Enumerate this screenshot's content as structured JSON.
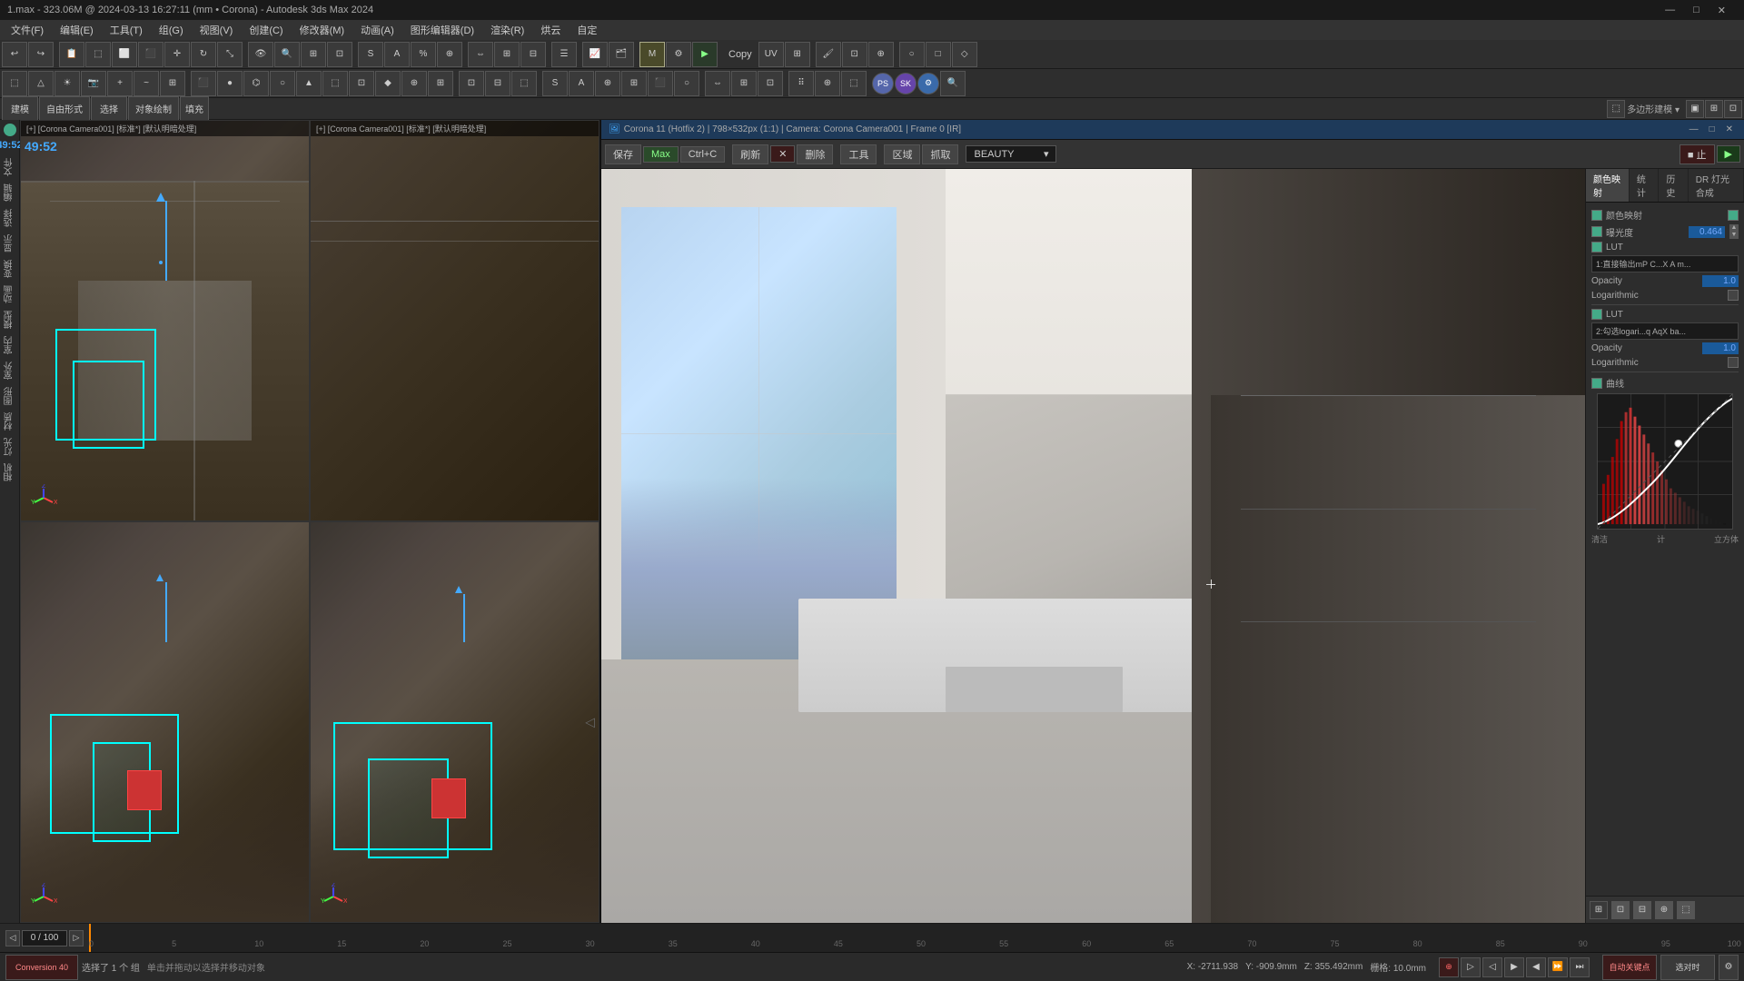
{
  "titleBar": {
    "text": "1.max - 323.06M @ 2024-03-13 16:27:11  (mm • Corona) - Autodesk 3ds Max 2024"
  },
  "menuBar": {
    "items": [
      "文件(F)",
      "编辑(E)",
      "工具(T)",
      "组(G)",
      "视图(V)",
      "创建(C)",
      "修改器(M)",
      "动画(A)",
      "图形编辑器(D)",
      "渲染(R)",
      "烘云",
      "自定"
    ]
  },
  "leftLabels": {
    "items": [
      "建模",
      "自由形式",
      "选择",
      "对象绘制",
      "填充"
    ]
  },
  "leftSidebar": {
    "items": [
      "文件",
      "编辑",
      "选择",
      "显示",
      "变换",
      "动画",
      "模型",
      "室内",
      "室外",
      "图形",
      "材质",
      "灯光",
      "相机",
      "—"
    ]
  },
  "viewports": {
    "topLeft": {
      "header": "[+] [Corona Camera001] [标准*] [默认明暗处理]"
    },
    "topRight": {
      "header": "[+] [Corona Camera001] [标准*] [默认明暗处理]"
    },
    "bottomLeft": {
      "header": ""
    },
    "bottomRight": {
      "header": ""
    }
  },
  "coronaVFB": {
    "title": "Corona 11 (Hotfix 2) | 798×532px (1:1) | Camera: Corona Camera001 | Frame 0 [IR]",
    "toolbar": {
      "save": "保存",
      "maxBtn": "Max",
      "ctrlC": "Ctrl+C",
      "clearBtn": "刷新",
      "removeBtn": "删除",
      "toolsBtn": "工具",
      "regionBtn": "区域",
      "grabBtn": "抓取",
      "beautyLabel": "BEAUTY",
      "stopBtn": "■ 止",
      "playBtn": "▶"
    }
  },
  "rightPanel": {
    "tabs": [
      "颜色映射",
      "统计",
      "历史",
      "DR 灯光合成"
    ],
    "colorMapping": {
      "topCheckLabel": "颜色映射",
      "exposureLabel": "曝光度",
      "exposureValue": "0.464",
      "lutLabel": "LUT",
      "lutEnabled": true,
      "lutValue": "1:直接输出mP C...X A m...",
      "opacityLabel": "Opacity",
      "opacityValue": "1.0",
      "logarithmicLabel1": "Logarithmic",
      "lut2Label": "LUT",
      "lut2Enabled": true,
      "lut2Value": "2:勾选logari...q AqX ba...",
      "opacity2Label": "Opacity",
      "opacity2Value": "1.0",
      "logarithmicLabel2": "Logarithmic",
      "curveLabel": "曲线",
      "curveEnabled": true,
      "footerLabels": [
        "清洁",
        "计",
        "立方体"
      ]
    }
  },
  "vfbBottomIcons": [
    "icon1",
    "icon2",
    "icon3",
    "icon4",
    "icon5",
    "icon6"
  ],
  "timeline": {
    "frameRange": "0 / 100",
    "ticks": [
      0,
      5,
      10,
      15,
      20,
      25,
      30,
      35,
      40,
      45,
      50,
      55,
      60,
      65,
      70,
      75,
      80,
      85,
      90,
      95,
      100
    ]
  },
  "statusBar": {
    "left": "选择了 1 个 组",
    "leftSub": "单击并拖动以选择并移动对象",
    "conversionBtn": "Conversion 40",
    "midItems": [
      "X: -2711.938",
      "Y: -909.9mm",
      "Z: 355.492mm",
      "栅格: 10.0mm",
      "自动关键点",
      "选对时"
    ],
    "coords": {
      "x": "X: -2711.938",
      "y": "Y: -909.9mm",
      "z": "Z: 355.492mm",
      "grid": "栅格: 10.0mm"
    },
    "right": ""
  },
  "playbackBar": {
    "frameInput": "0",
    "frameTotal": "100",
    "buttons": [
      "⏮",
      "⏪",
      "◀",
      "▶",
      "▷",
      "⏩",
      "⏭"
    ]
  },
  "toolbar1": {
    "undoBtn": "↩",
    "redoBtn": "↪"
  },
  "copyLabel": "Copy"
}
